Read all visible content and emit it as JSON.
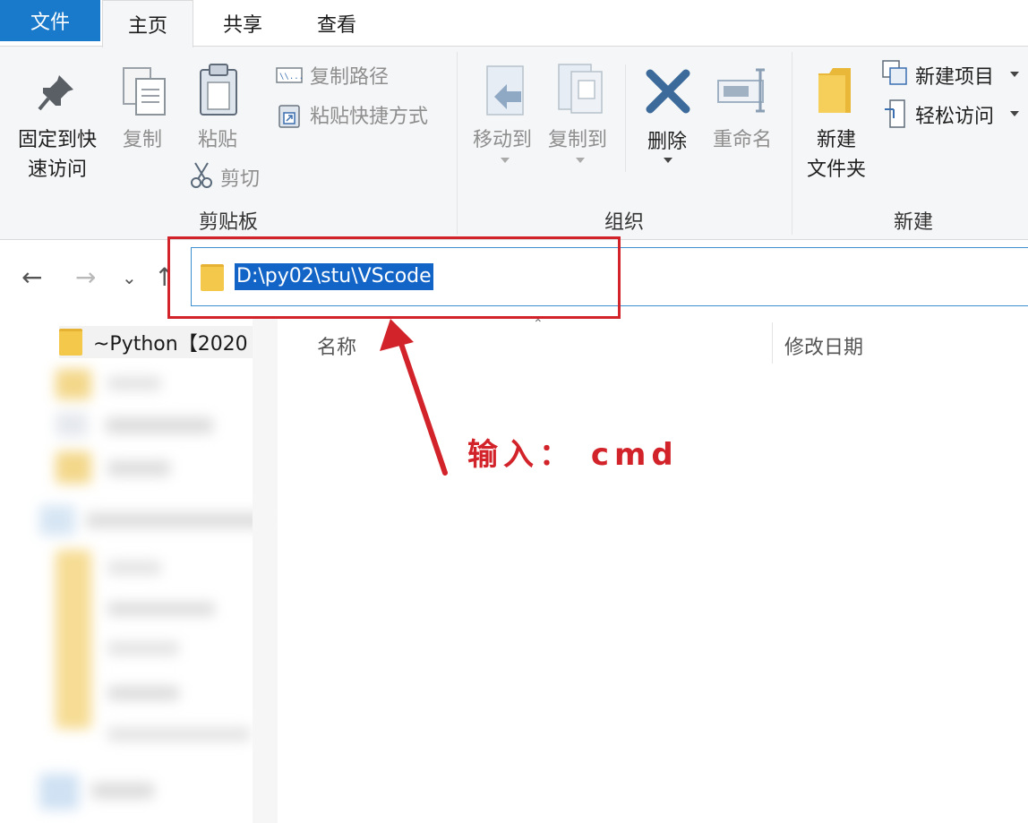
{
  "ribbon_tabs": {
    "file": "文件",
    "home": "主页",
    "share": "共享",
    "view": "查看"
  },
  "clipboard_group": {
    "pin_line1": "固定到快",
    "pin_line2": "速访问",
    "copy": "复制",
    "paste": "粘贴",
    "copy_path": "复制路径",
    "paste_shortcut": "粘贴快捷方式",
    "cut": "剪切",
    "label": "剪贴板"
  },
  "organize_group": {
    "move_to": "移动到",
    "copy_to": "复制到",
    "delete": "删除",
    "rename": "重命名",
    "label": "组织"
  },
  "new_group": {
    "new_folder_line1": "新建",
    "new_folder_line2": "文件夹",
    "new_item": "新建项目",
    "easy_access": "轻松访问",
    "label": "新建"
  },
  "address_bar": {
    "path": "D:\\py02\\stu\\VScode"
  },
  "nav_pane": {
    "item_label": "~Python【2020"
  },
  "columns": {
    "name": "名称",
    "modified": "修改日期"
  },
  "annotation": {
    "text": "输入： cmd",
    "color": "#d3232a"
  },
  "colors": {
    "file_tab": "#1979ca",
    "selection": "#1364c7",
    "folder": "#f3c84b"
  }
}
